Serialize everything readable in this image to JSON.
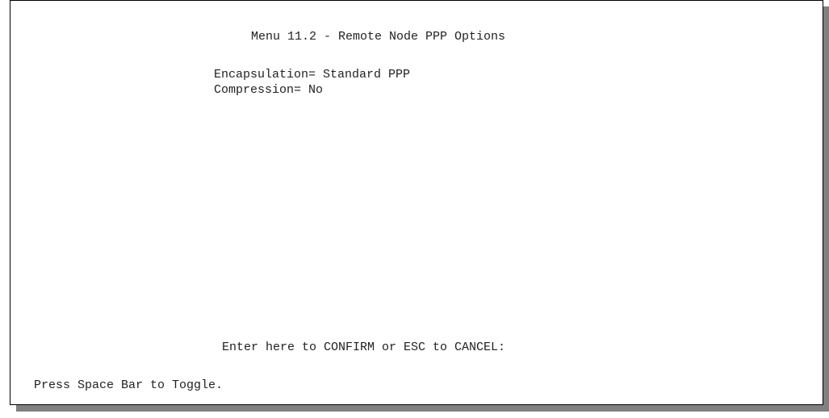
{
  "menu": {
    "title": "Menu 11.2 - Remote Node PPP Options"
  },
  "fields": [
    {
      "label": "Encapsulation= ",
      "value": "Standard PPP"
    },
    {
      "label": "Compression= ",
      "value": "No"
    }
  ],
  "footer": {
    "confirm_prompt": "Enter here to CONFIRM or ESC to CANCEL:",
    "hint": "Press Space Bar to Toggle."
  },
  "colors": {
    "background": "#ffffff",
    "text": "#222222",
    "border": "#000000",
    "shadow": "#808080"
  }
}
